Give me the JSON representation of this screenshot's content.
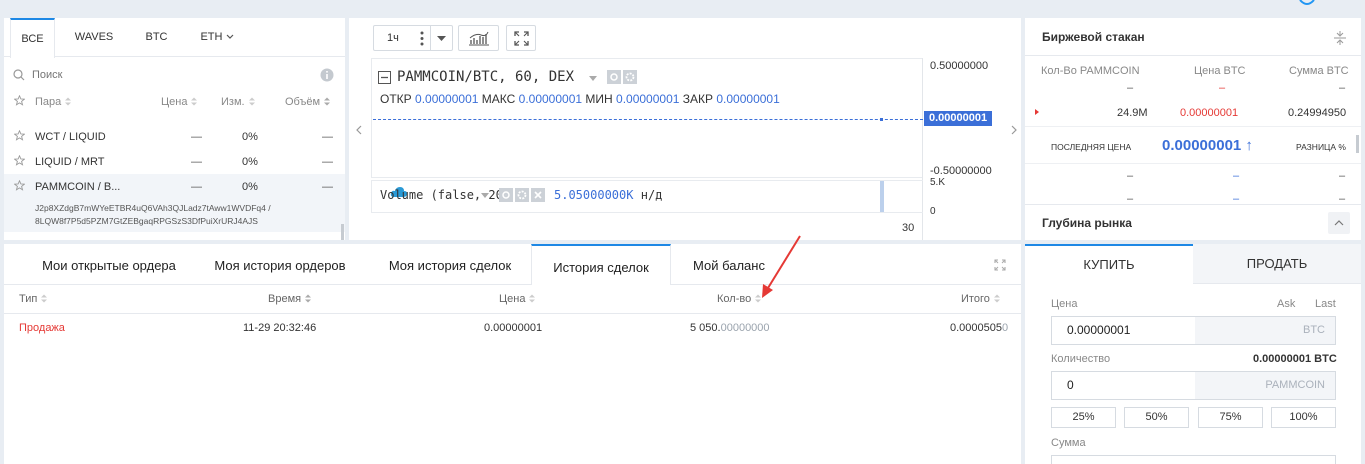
{
  "pairs": {
    "tabs": [
      "ВСЕ",
      "WAVES",
      "BTC",
      "ETH"
    ],
    "search_placeholder": "Поиск",
    "headers": {
      "pair": "Пара",
      "price": "Цена",
      "change": "Изм.",
      "volume": "Объём"
    },
    "rows": [
      {
        "pair": "WCT / LIQUID",
        "price": "—",
        "change": "0%",
        "volume": "—"
      },
      {
        "pair": "LIQUID / MRT",
        "price": "—",
        "change": "0%",
        "volume": "—"
      },
      {
        "pair": "PAMMCOIN / B...",
        "price": "—",
        "change": "0%",
        "volume": "—"
      }
    ],
    "selected_id": "J2p8XZdgB7mWYeETBR4uQ6VAh3QJLadz7tAww1WVDFq4 / 8LQW8f7P5d5PZM7GtZEBgaqRPGSzS3DfPuiXrURJ4AJS"
  },
  "chart": {
    "interval": "1ч",
    "symbol": "PAMMCOIN/BTC, 60, DEX",
    "ohlc": {
      "open_label": "ОТКР",
      "open": "0.00000001",
      "high_label": "МАКС",
      "high": "0.00000001",
      "low_label": "МИН",
      "low": "0.00000001",
      "close_label": "ЗАКР",
      "close": "0.00000001"
    },
    "y_top": "0.50000000",
    "y_current": "0.00000001",
    "y_bottom": "-0.50000000",
    "volume_label": "Volume (false, 20)",
    "volume_value": "5.05000000K",
    "volume_na": "н/д",
    "vol_axis_top": "5.K",
    "vol_axis_bottom": "0",
    "x_tick": "30"
  },
  "book": {
    "title": "Биржевой стакан",
    "headers": {
      "amount": "Кол-Во PAMMCOIN",
      "price": "Цена BTC",
      "sum": "Сумма BTC"
    },
    "row": {
      "amount": "24.9M",
      "price": "0.00000001",
      "sum": "0.24994950"
    },
    "last_price_label": "ПОСЛЕДНЯЯ ЦЕНА",
    "last_price": "0.00000001 ↑",
    "diff_label": "РАЗНИЦА %",
    "depth_title": "Глубина рынка"
  },
  "trades": {
    "tabs": [
      "Мои открытые ордера",
      "Моя история ордеров",
      "Моя история сделок",
      "История сделок",
      "Мой баланс"
    ],
    "active_tab": "История сделок",
    "headers": {
      "type": "Тип",
      "time": "Время",
      "price": "Цена",
      "amount": "Кол-во",
      "total": "Итого"
    },
    "rows": [
      {
        "type": "Продажа",
        "time": "11-29 20:32:46",
        "price": "0.00000001",
        "amount_main": "5 050.",
        "amount_zeros": "00000000",
        "total_main": "0.0000505",
        "total_zero": "0"
      }
    ]
  },
  "order_form": {
    "buy_tab": "КУПИТЬ",
    "sell_tab": "ПРОДАТЬ",
    "price_label": "Цена",
    "ask_label": "Ask",
    "last_label": "Last",
    "price_value": "0.00000001",
    "price_unit": "BTC",
    "qty_label": "Количество",
    "qty_available": "0.00000001 BTC",
    "qty_value": "0",
    "qty_unit": "PAMMCOIN",
    "percents": [
      "25%",
      "50%",
      "75%",
      "100%"
    ],
    "sum_label": "Сумма"
  },
  "colors": {
    "accent": "#1e88e5",
    "sell": "#e53935",
    "price_blue": "#3b6fd8"
  }
}
